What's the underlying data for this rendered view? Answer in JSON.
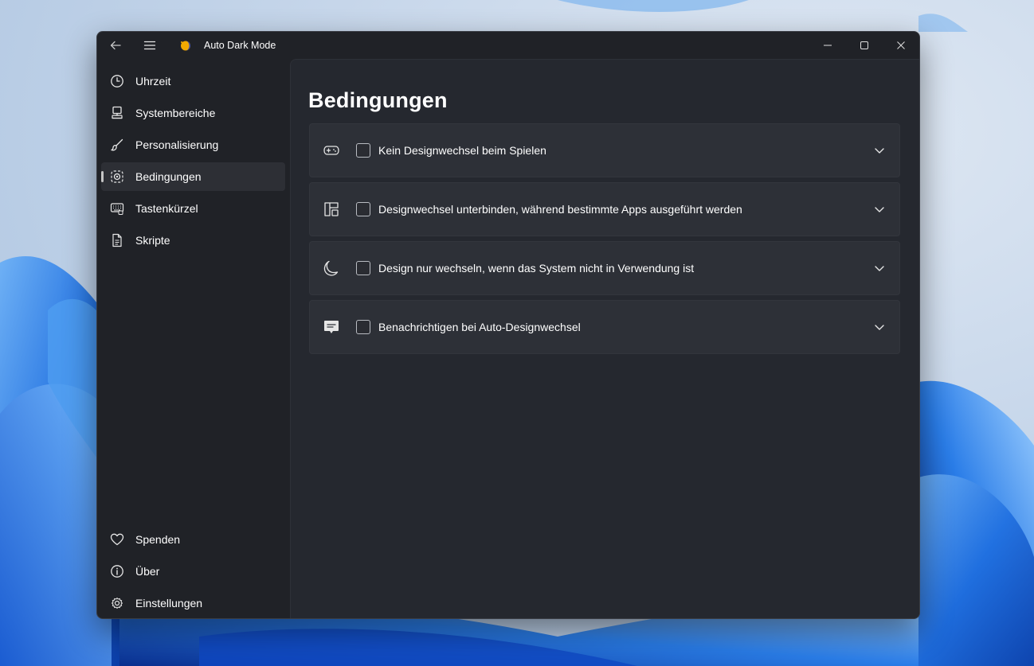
{
  "window": {
    "title": "Auto Dark Mode"
  },
  "titlebar": {
    "back_icon": "back-arrow-icon",
    "menu_icon": "hamburger-icon",
    "controls": [
      "minimize-icon",
      "maximize-icon",
      "close-icon"
    ]
  },
  "sidebar": {
    "items": [
      {
        "label": "Uhrzeit",
        "icon": "clock-icon",
        "active": false
      },
      {
        "label": "Systembereiche",
        "icon": "desktop-icon",
        "active": false
      },
      {
        "label": "Personalisierung",
        "icon": "brush-icon",
        "active": false
      },
      {
        "label": "Bedingungen",
        "icon": "condition-icon",
        "active": true
      },
      {
        "label": "Tastenkürzel",
        "icon": "keyboard-icon",
        "active": false
      },
      {
        "label": "Skripte",
        "icon": "document-icon",
        "active": false
      }
    ],
    "footer_items": [
      {
        "label": "Spenden",
        "icon": "heart-icon"
      },
      {
        "label": "Über",
        "icon": "info-icon"
      },
      {
        "label": "Einstellungen",
        "icon": "gear-icon"
      }
    ]
  },
  "main": {
    "title": "Bedingungen",
    "cards": [
      {
        "label": "Kein Designwechsel beim Spielen",
        "icon": "gamepad-icon",
        "checked": false
      },
      {
        "label": "Designwechsel unterbinden, während bestimmte Apps ausgeführt werden",
        "icon": "apps-icon",
        "checked": false
      },
      {
        "label": "Design nur wechseln, wenn das System nicht in Verwendung ist",
        "icon": "moon-icon",
        "checked": false
      },
      {
        "label": "Benachrichtigen bei Auto-Designwechsel",
        "icon": "message-icon",
        "checked": false
      }
    ]
  },
  "colors": {
    "window_bg": "#202227",
    "content_bg": "#25282f",
    "card_bg": "#2d3037",
    "text": "#ffffff",
    "active_item_bg": "#2d2f35"
  }
}
